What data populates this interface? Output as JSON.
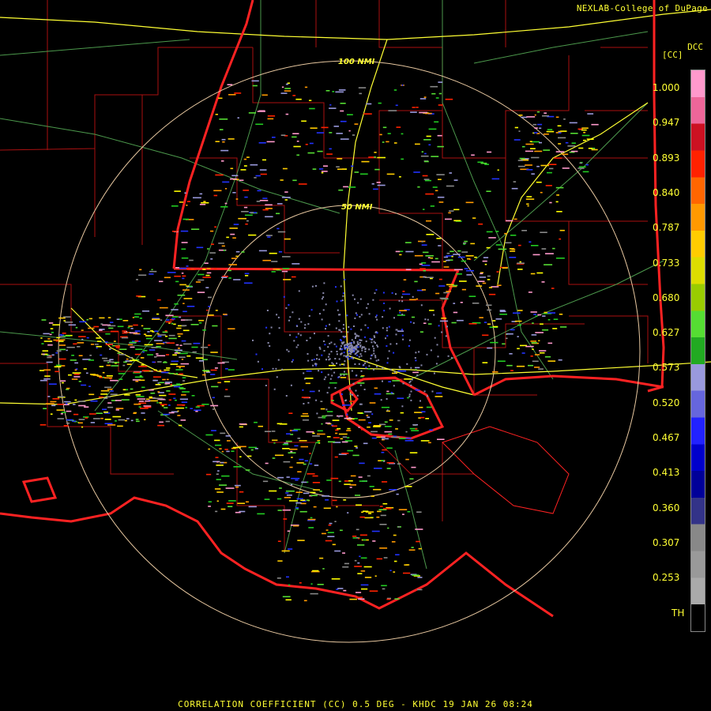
{
  "credit": "NEXLAB-College of DuPage",
  "product_code": "DCC",
  "unit_label": "[CC]",
  "footer": "CORRELATION COEFFICIENT (CC) 0.5 DEG - KHDC 19 JAN 26 08:24",
  "range_rings": {
    "inner": "50 NMI",
    "outer": "100 NMI"
  },
  "colorbar": {
    "labels": [
      "1.000",
      "0.947",
      "0.893",
      "0.840",
      "0.787",
      "0.733",
      "0.680",
      "0.627",
      "0.573",
      "0.520",
      "0.467",
      "0.413",
      "0.360",
      "0.307",
      "0.253",
      "TH"
    ],
    "colors": [
      "#ff99cc",
      "#ee6699",
      "#cc1122",
      "#ff2200",
      "#ff6600",
      "#ff9900",
      "#ffcc00",
      "#dddd00",
      "#99cc00",
      "#55dd33",
      "#22aa22",
      "#9999dd",
      "#6666dd",
      "#2222ff",
      "#0000cc",
      "#000099",
      "#333388",
      "#888888",
      "#999999",
      "#aaaaaa",
      "#000000"
    ]
  },
  "colors": {
    "state_border": "#ff2222",
    "county": "#aa1111",
    "highway": "#ffff33",
    "road": "#55aa55",
    "ring": "#e8c8a0",
    "text": "#ffff33"
  }
}
